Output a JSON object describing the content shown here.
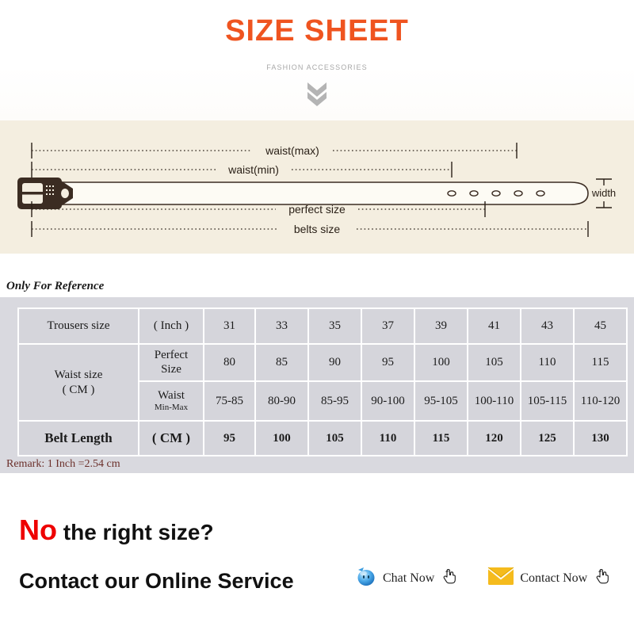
{
  "header": {
    "title": "SIZE SHEET",
    "subtitle": "FASHION ACCESSORIES",
    "chevron_icon": "double-chevron-down-icon",
    "title_color": "#ef5420",
    "subtitle_color": "#a8a8a8"
  },
  "diagram": {
    "panel_bg": "#f4eee0",
    "labels": {
      "waist_max": "waist(max)",
      "waist_min": "waist(min)",
      "perfect_size": "perfect size",
      "belts_size": "belts size",
      "width": "width"
    },
    "belt_hole_count": 5,
    "belt_color": "#3b2c22"
  },
  "reference_note": "Only For Reference",
  "table": {
    "rows": [
      {
        "label": "Trousers size",
        "unit": "( Inch )",
        "values": [
          "31",
          "33",
          "35",
          "37",
          "39",
          "41",
          "43",
          "45"
        ]
      },
      {
        "label": "Waist size\n( CM )",
        "unit": "Perfect Size",
        "unit_line1": "Perfect",
        "unit_line2": "Size",
        "values": [
          "80",
          "85",
          "90",
          "95",
          "100",
          "105",
          "110",
          "115"
        ]
      },
      {
        "label": "",
        "unit": "Waist Min-Max",
        "unit_line1": "Waist",
        "unit_line2": "Min-Max",
        "values": [
          "75-85",
          "80-90",
          "85-95",
          "90-100",
          "95-105",
          "100-110",
          "105-115",
          "110-120"
        ]
      },
      {
        "label": "Belt Length",
        "unit": "( CM )",
        "values": [
          "95",
          "100",
          "105",
          "110",
          "115",
          "120",
          "125",
          "130"
        ]
      }
    ],
    "waist_label_line1": "Waist size",
    "waist_label_line2": "( CM )",
    "band_color": "#d9d9df",
    "cell_color": "#d5d5db"
  },
  "remark": "Remark: 1 Inch =2.54 cm",
  "remark_color": "#6b2f2a",
  "bottom": {
    "no_word": "No",
    "no_rest": " the right size?",
    "contact_heading": "Contact our Online Service",
    "no_word_color": "#ee0000",
    "chat": {
      "label": "Chat Now",
      "icon": "chat-bubble-icon",
      "cursor_icon": "hand-pointer-icon"
    },
    "contact": {
      "label": "Contact Now",
      "icon": "envelope-icon",
      "cursor_icon": "hand-pointer-icon"
    }
  }
}
